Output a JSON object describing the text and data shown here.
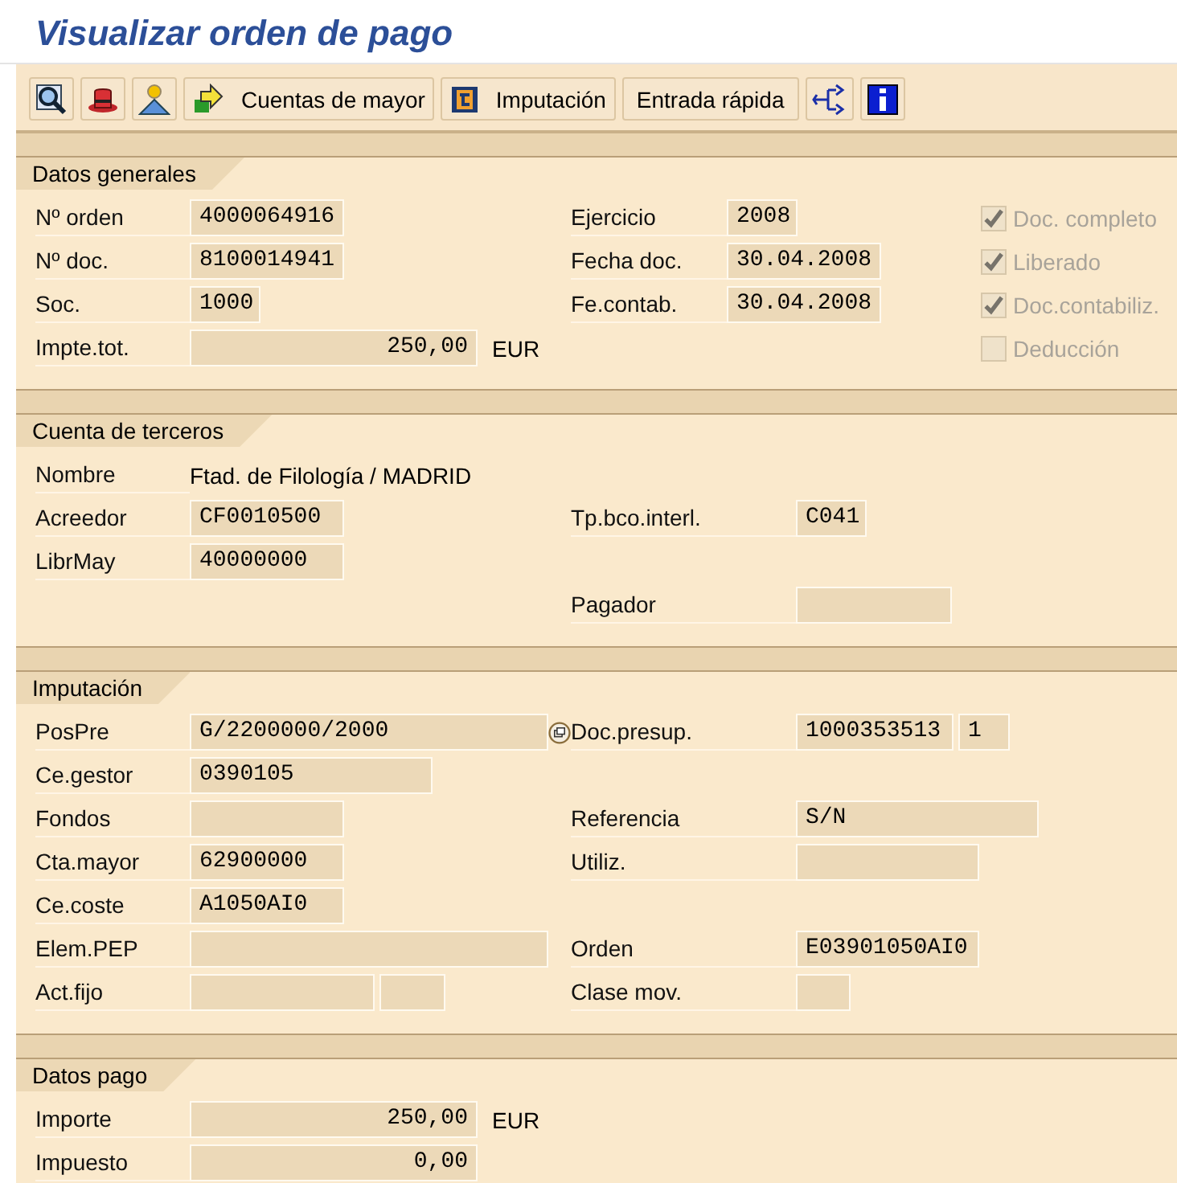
{
  "title": "Visualizar orden de pago",
  "toolbar": [
    {
      "kind": "icon"
    },
    {
      "kind": "icon"
    },
    {
      "kind": "icon"
    },
    {
      "kind": "icon_text",
      "label": "Cuentas de mayor"
    },
    {
      "kind": "icon_text",
      "label": "Imputación"
    },
    {
      "kind": "text",
      "label": "Entrada rápida"
    },
    {
      "kind": "icon"
    },
    {
      "kind": "icon"
    }
  ],
  "sections": [
    {
      "title": "Datos generales",
      "rows": [
        {
          "left": {
            "label": "Nº orden",
            "fields": [
              {
                "value": "4000064916"
              }
            ]
          },
          "right": {
            "label": "Ejercicio",
            "fields": [
              {
                "value": "2008"
              }
            ]
          },
          "check": {
            "label": "Doc. completo",
            "checked": true,
            "disabled": true
          }
        },
        {
          "left": {
            "label": "Nº doc.",
            "fields": [
              {
                "value": "8100014941"
              }
            ]
          },
          "right": {
            "label": "Fecha doc.",
            "fields": [
              {
                "value": "30.04.2008"
              }
            ]
          },
          "check": {
            "label": "Liberado",
            "checked": true,
            "disabled": true
          }
        },
        {
          "left": {
            "label": "Soc.",
            "fields": [
              {
                "value": "1000"
              }
            ]
          },
          "right": {
            "label": "Fe.contab.",
            "fields": [
              {
                "value": "30.04.2008"
              }
            ]
          },
          "check": {
            "label": "Doc.contabiliz.",
            "checked": true,
            "disabled": true
          }
        },
        {
          "left": {
            "label": "Impte.tot.",
            "fields": [
              {
                "value": "250,00",
                "kind": "amount"
              }
            ],
            "unit": "EUR"
          },
          "check": {
            "label": "Deducción",
            "checked": false,
            "disabled": true
          }
        }
      ]
    },
    {
      "title": "Cuenta de terceros",
      "rows": [
        {
          "left": {
            "label": "Nombre",
            "text": "Ftad. de Filología / MADRID"
          }
        },
        {
          "left": {
            "label": "Acreedor",
            "fields": [
              {
                "value": "CF0010500"
              }
            ]
          },
          "right": {
            "label": "Tp.bco.interl.",
            "fields": [
              {
                "value": "C041"
              }
            ]
          }
        },
        {
          "left": {
            "label": "LibrMay",
            "fields": [
              {
                "value": "40000000"
              }
            ]
          }
        },
        {
          "right": {
            "label": "Pagador"
          }
        }
      ]
    },
    {
      "title": "Imputación",
      "rows": [
        {
          "left": {
            "label": "PosPre",
            "fields": [
              {
                "value": "G/2200000/2000"
              }
            ],
            "link": true
          },
          "right": {
            "label": "Doc.presup.",
            "fields": [
              {
                "value": "1000353513"
              },
              {
                "value": "1"
              }
            ]
          }
        },
        {
          "left": {
            "label": "Ce.gestor",
            "fields": [
              {
                "value": "0390105"
              }
            ]
          }
        },
        {
          "left": {
            "label": "Fondos"
          },
          "right": {
            "label": "Referencia",
            "fields": [
              {
                "value": "S/N"
              }
            ]
          }
        },
        {
          "left": {
            "label": "Cta.mayor",
            "fields": [
              {
                "value": "62900000"
              }
            ]
          },
          "right": {
            "label": "Utiliz."
          }
        },
        {
          "left": {
            "label": "Ce.coste",
            "fields": [
              {
                "value": "A1050AI0"
              }
            ]
          }
        },
        {
          "left": {
            "label": "Elem.PEP"
          },
          "right": {
            "label": "Orden",
            "fields": [
              {
                "value": "E03901050AI0"
              }
            ]
          }
        },
        {
          "left": {
            "label": "Act.fijo"
          },
          "right": {
            "label": "Clase mov."
          }
        }
      ]
    },
    {
      "title": "Datos pago",
      "rows": [
        {
          "left": {
            "label": "Importe",
            "fields": [
              {
                "value": "250,00",
                "kind": "amount"
              }
            ],
            "unit": "EUR"
          }
        },
        {
          "left": {
            "label": "Impuesto",
            "fields": [
              {
                "value": "0,00",
                "kind": "amount"
              }
            ]
          }
        }
      ]
    }
  ]
}
